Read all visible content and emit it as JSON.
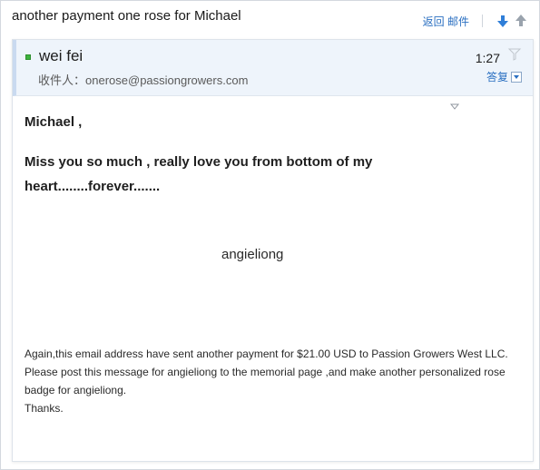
{
  "subject": "another payment one rose for Michael",
  "top_actions": {
    "back_label": "返回 邮件",
    "down_icon": "arrow-down-icon",
    "up_icon": "arrow-up-icon"
  },
  "message": {
    "sender": "wei fei",
    "recipient_prefix": "收件人：",
    "recipient_email": "onerose@passiongrowers.com",
    "time": "1:27",
    "reply_label": "答复"
  },
  "body": {
    "greeting": "Michael ,",
    "love_text": "Miss you so much , really love you from bottom of my heart........forever.......",
    "signature": "angieliong",
    "notes": [
      "Again,this email address  have  sent another  payment for $21.00 USD to Passion Growers West LLC.",
      "Please post this message for angieliong to the memorial page ,and make another personalized rose badge for angieliong.",
      "Thanks."
    ]
  },
  "colors": {
    "link": "#2a6fc1",
    "header_bg": "#eef4fb",
    "online": "#3db33d",
    "arrow_blue": "#2f7ed8",
    "arrow_gray": "#9aa3ad"
  }
}
